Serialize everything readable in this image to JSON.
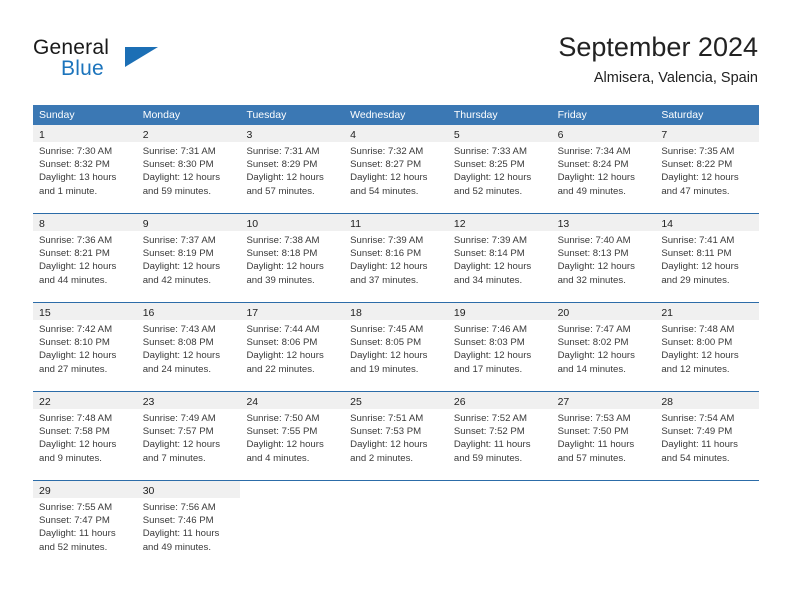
{
  "logo": {
    "word1": "General",
    "word2": "Blue",
    "triangle_color": "#1c6fb5",
    "blue_color": "#1c74bc"
  },
  "header": {
    "title": "September 2024",
    "subtitle": "Almisera, Valencia, Spain"
  },
  "calendar": {
    "header_bg": "#3b78b4",
    "daynum_bg": "#f0f0f0",
    "weekdays": [
      "Sunday",
      "Monday",
      "Tuesday",
      "Wednesday",
      "Thursday",
      "Friday",
      "Saturday"
    ],
    "weeks": [
      [
        {
          "day": "1",
          "sunrise": "Sunrise: 7:30 AM",
          "sunset": "Sunset: 8:32 PM",
          "daylight1": "Daylight: 13 hours",
          "daylight2": "and 1 minute."
        },
        {
          "day": "2",
          "sunrise": "Sunrise: 7:31 AM",
          "sunset": "Sunset: 8:30 PM",
          "daylight1": "Daylight: 12 hours",
          "daylight2": "and 59 minutes."
        },
        {
          "day": "3",
          "sunrise": "Sunrise: 7:31 AM",
          "sunset": "Sunset: 8:29 PM",
          "daylight1": "Daylight: 12 hours",
          "daylight2": "and 57 minutes."
        },
        {
          "day": "4",
          "sunrise": "Sunrise: 7:32 AM",
          "sunset": "Sunset: 8:27 PM",
          "daylight1": "Daylight: 12 hours",
          "daylight2": "and 54 minutes."
        },
        {
          "day": "5",
          "sunrise": "Sunrise: 7:33 AM",
          "sunset": "Sunset: 8:25 PM",
          "daylight1": "Daylight: 12 hours",
          "daylight2": "and 52 minutes."
        },
        {
          "day": "6",
          "sunrise": "Sunrise: 7:34 AM",
          "sunset": "Sunset: 8:24 PM",
          "daylight1": "Daylight: 12 hours",
          "daylight2": "and 49 minutes."
        },
        {
          "day": "7",
          "sunrise": "Sunrise: 7:35 AM",
          "sunset": "Sunset: 8:22 PM",
          "daylight1": "Daylight: 12 hours",
          "daylight2": "and 47 minutes."
        }
      ],
      [
        {
          "day": "8",
          "sunrise": "Sunrise: 7:36 AM",
          "sunset": "Sunset: 8:21 PM",
          "daylight1": "Daylight: 12 hours",
          "daylight2": "and 44 minutes."
        },
        {
          "day": "9",
          "sunrise": "Sunrise: 7:37 AM",
          "sunset": "Sunset: 8:19 PM",
          "daylight1": "Daylight: 12 hours",
          "daylight2": "and 42 minutes."
        },
        {
          "day": "10",
          "sunrise": "Sunrise: 7:38 AM",
          "sunset": "Sunset: 8:18 PM",
          "daylight1": "Daylight: 12 hours",
          "daylight2": "and 39 minutes."
        },
        {
          "day": "11",
          "sunrise": "Sunrise: 7:39 AM",
          "sunset": "Sunset: 8:16 PM",
          "daylight1": "Daylight: 12 hours",
          "daylight2": "and 37 minutes."
        },
        {
          "day": "12",
          "sunrise": "Sunrise: 7:39 AM",
          "sunset": "Sunset: 8:14 PM",
          "daylight1": "Daylight: 12 hours",
          "daylight2": "and 34 minutes."
        },
        {
          "day": "13",
          "sunrise": "Sunrise: 7:40 AM",
          "sunset": "Sunset: 8:13 PM",
          "daylight1": "Daylight: 12 hours",
          "daylight2": "and 32 minutes."
        },
        {
          "day": "14",
          "sunrise": "Sunrise: 7:41 AM",
          "sunset": "Sunset: 8:11 PM",
          "daylight1": "Daylight: 12 hours",
          "daylight2": "and 29 minutes."
        }
      ],
      [
        {
          "day": "15",
          "sunrise": "Sunrise: 7:42 AM",
          "sunset": "Sunset: 8:10 PM",
          "daylight1": "Daylight: 12 hours",
          "daylight2": "and 27 minutes."
        },
        {
          "day": "16",
          "sunrise": "Sunrise: 7:43 AM",
          "sunset": "Sunset: 8:08 PM",
          "daylight1": "Daylight: 12 hours",
          "daylight2": "and 24 minutes."
        },
        {
          "day": "17",
          "sunrise": "Sunrise: 7:44 AM",
          "sunset": "Sunset: 8:06 PM",
          "daylight1": "Daylight: 12 hours",
          "daylight2": "and 22 minutes."
        },
        {
          "day": "18",
          "sunrise": "Sunrise: 7:45 AM",
          "sunset": "Sunset: 8:05 PM",
          "daylight1": "Daylight: 12 hours",
          "daylight2": "and 19 minutes."
        },
        {
          "day": "19",
          "sunrise": "Sunrise: 7:46 AM",
          "sunset": "Sunset: 8:03 PM",
          "daylight1": "Daylight: 12 hours",
          "daylight2": "and 17 minutes."
        },
        {
          "day": "20",
          "sunrise": "Sunrise: 7:47 AM",
          "sunset": "Sunset: 8:02 PM",
          "daylight1": "Daylight: 12 hours",
          "daylight2": "and 14 minutes."
        },
        {
          "day": "21",
          "sunrise": "Sunrise: 7:48 AM",
          "sunset": "Sunset: 8:00 PM",
          "daylight1": "Daylight: 12 hours",
          "daylight2": "and 12 minutes."
        }
      ],
      [
        {
          "day": "22",
          "sunrise": "Sunrise: 7:48 AM",
          "sunset": "Sunset: 7:58 PM",
          "daylight1": "Daylight: 12 hours",
          "daylight2": "and 9 minutes."
        },
        {
          "day": "23",
          "sunrise": "Sunrise: 7:49 AM",
          "sunset": "Sunset: 7:57 PM",
          "daylight1": "Daylight: 12 hours",
          "daylight2": "and 7 minutes."
        },
        {
          "day": "24",
          "sunrise": "Sunrise: 7:50 AM",
          "sunset": "Sunset: 7:55 PM",
          "daylight1": "Daylight: 12 hours",
          "daylight2": "and 4 minutes."
        },
        {
          "day": "25",
          "sunrise": "Sunrise: 7:51 AM",
          "sunset": "Sunset: 7:53 PM",
          "daylight1": "Daylight: 12 hours",
          "daylight2": "and 2 minutes."
        },
        {
          "day": "26",
          "sunrise": "Sunrise: 7:52 AM",
          "sunset": "Sunset: 7:52 PM",
          "daylight1": "Daylight: 11 hours",
          "daylight2": "and 59 minutes."
        },
        {
          "day": "27",
          "sunrise": "Sunrise: 7:53 AM",
          "sunset": "Sunset: 7:50 PM",
          "daylight1": "Daylight: 11 hours",
          "daylight2": "and 57 minutes."
        },
        {
          "day": "28",
          "sunrise": "Sunrise: 7:54 AM",
          "sunset": "Sunset: 7:49 PM",
          "daylight1": "Daylight: 11 hours",
          "daylight2": "and 54 minutes."
        }
      ],
      [
        {
          "day": "29",
          "sunrise": "Sunrise: 7:55 AM",
          "sunset": "Sunset: 7:47 PM",
          "daylight1": "Daylight: 11 hours",
          "daylight2": "and 52 minutes."
        },
        {
          "day": "30",
          "sunrise": "Sunrise: 7:56 AM",
          "sunset": "Sunset: 7:46 PM",
          "daylight1": "Daylight: 11 hours",
          "daylight2": "and 49 minutes."
        },
        {
          "day": "",
          "sunrise": "",
          "sunset": "",
          "daylight1": "",
          "daylight2": ""
        },
        {
          "day": "",
          "sunrise": "",
          "sunset": "",
          "daylight1": "",
          "daylight2": ""
        },
        {
          "day": "",
          "sunrise": "",
          "sunset": "",
          "daylight1": "",
          "daylight2": ""
        },
        {
          "day": "",
          "sunrise": "",
          "sunset": "",
          "daylight1": "",
          "daylight2": ""
        },
        {
          "day": "",
          "sunrise": "",
          "sunset": "",
          "daylight1": "",
          "daylight2": ""
        }
      ]
    ]
  }
}
